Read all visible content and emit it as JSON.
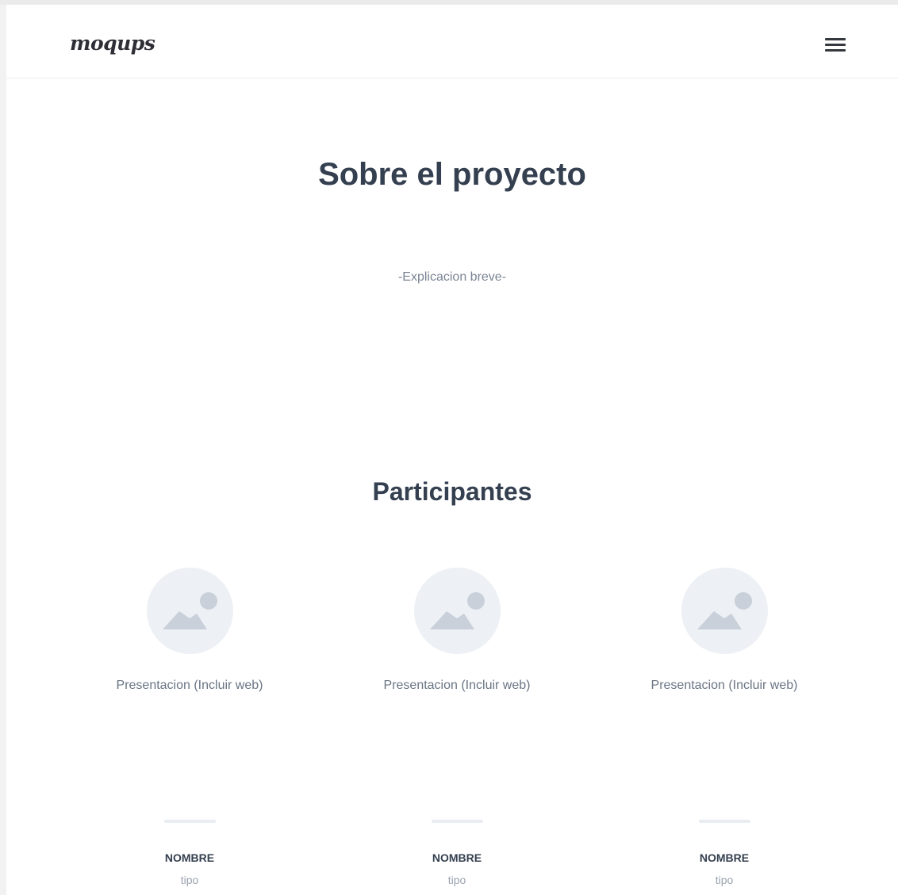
{
  "header": {
    "logo_text": "moqups",
    "menu_icon": "hamburger-menu-icon"
  },
  "about": {
    "title": "Sobre el proyecto",
    "description": "-Explicacion breve-"
  },
  "participants": {
    "title": "Participantes",
    "avatar_icon": "image-placeholder-icon",
    "items": [
      {
        "presentation": "Presentacion (Incluir web)",
        "name": "NOMBRE",
        "role": "tipo"
      },
      {
        "presentation": "Presentacion (Incluir web)",
        "name": "NOMBRE",
        "role": "tipo"
      },
      {
        "presentation": "Presentacion (Incluir web)",
        "name": "NOMBRE",
        "role": "tipo"
      }
    ]
  },
  "colors": {
    "heading": "#343f4f",
    "body_text": "#6a7585",
    "placeholder_bg": "#edf0f4",
    "placeholder_icon": "#c9d0da"
  }
}
